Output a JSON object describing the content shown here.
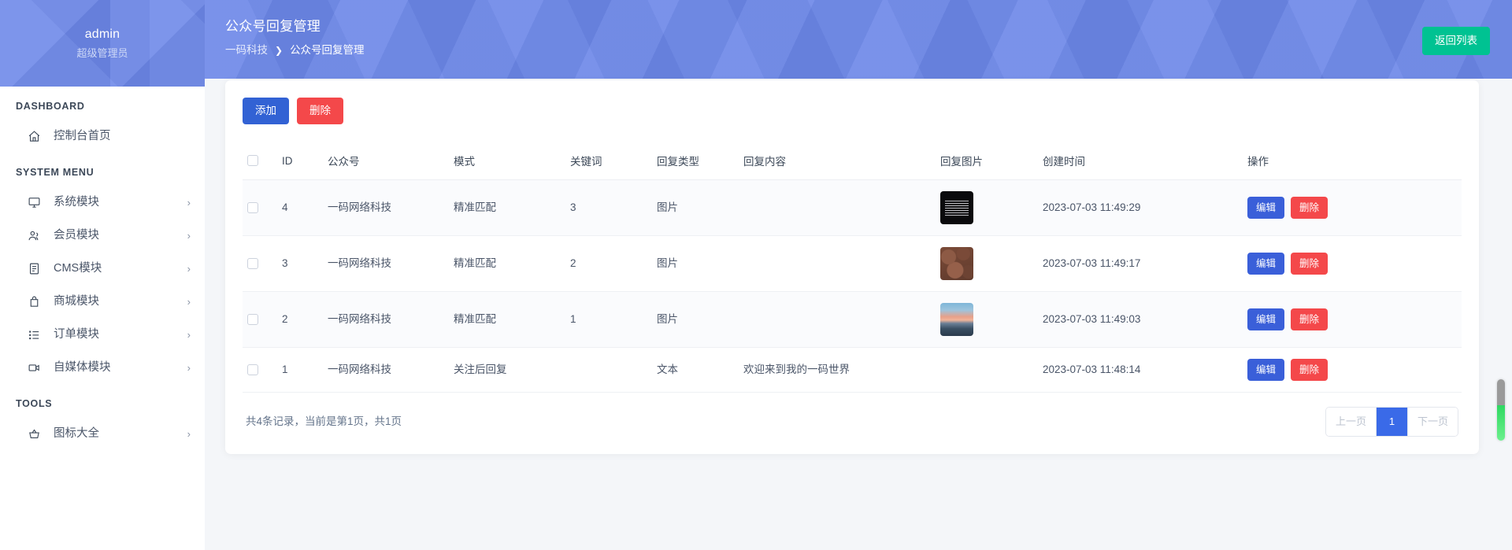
{
  "sidebar": {
    "profile": {
      "username": "admin",
      "role": "超级管理员"
    },
    "sections": [
      {
        "title": "DASHBOARD",
        "items": [
          {
            "label": "控制台首页",
            "icon": "home-icon",
            "chevron": ""
          }
        ]
      },
      {
        "title": "SYSTEM MENU",
        "items": [
          {
            "label": "系统模块",
            "icon": "monitor-icon",
            "chevron": "›"
          },
          {
            "label": "会员模块",
            "icon": "users-icon",
            "chevron": "›"
          },
          {
            "label": "CMS模块",
            "icon": "document-icon",
            "chevron": "›"
          },
          {
            "label": "商城模块",
            "icon": "bag-icon",
            "chevron": "›"
          },
          {
            "label": "订单模块",
            "icon": "list-icon",
            "chevron": "›"
          },
          {
            "label": "自媒体模块",
            "icon": "video-icon",
            "chevron": "›"
          }
        ]
      },
      {
        "title": "TOOLS",
        "items": [
          {
            "label": "图标大全",
            "icon": "basket-icon",
            "chevron": "›"
          }
        ]
      }
    ]
  },
  "header": {
    "title": "公众号回复管理",
    "breadcrumb": {
      "root": "一码科技",
      "separator": "❯",
      "current": "公众号回复管理"
    },
    "return_button": "返回列表"
  },
  "toolbar": {
    "add_label": "添加",
    "delete_label": "删除"
  },
  "table": {
    "columns": [
      "",
      "ID",
      "公众号",
      "模式",
      "关键词",
      "回复类型",
      "回复内容",
      "回复图片",
      "创建时间",
      "操作"
    ],
    "rows": [
      {
        "id": "4",
        "account": "一码网络科技",
        "mode": "精准匹配",
        "keyword": "3",
        "reply_type": "图片",
        "reply_content": "",
        "image": "thumb-1",
        "created": "2023-07-03 11:49:29",
        "edit": "编辑",
        "delete": "删除"
      },
      {
        "id": "3",
        "account": "一码网络科技",
        "mode": "精准匹配",
        "keyword": "2",
        "reply_type": "图片",
        "reply_content": "",
        "image": "thumb-2",
        "created": "2023-07-03 11:49:17",
        "edit": "编辑",
        "delete": "删除"
      },
      {
        "id": "2",
        "account": "一码网络科技",
        "mode": "精准匹配",
        "keyword": "1",
        "reply_type": "图片",
        "reply_content": "",
        "image": "thumb-3",
        "created": "2023-07-03 11:49:03",
        "edit": "编辑",
        "delete": "删除"
      },
      {
        "id": "1",
        "account": "一码网络科技",
        "mode": "关注后回复",
        "keyword": "",
        "reply_type": "文本",
        "reply_content": "欢迎来到我的一码世界",
        "image": "",
        "created": "2023-07-03 11:48:14",
        "edit": "编辑",
        "delete": "删除"
      }
    ]
  },
  "footer": {
    "record_info": "共4条记录，当前是第1页，共1页",
    "pagination": {
      "prev": "上一页",
      "current": "1",
      "next": "下一页"
    }
  },
  "colors": {
    "brand": "#6c87e8",
    "primary": "#3262d4",
    "danger": "#f4484a",
    "success": "#00c292",
    "active_page": "#3a6ae8"
  }
}
